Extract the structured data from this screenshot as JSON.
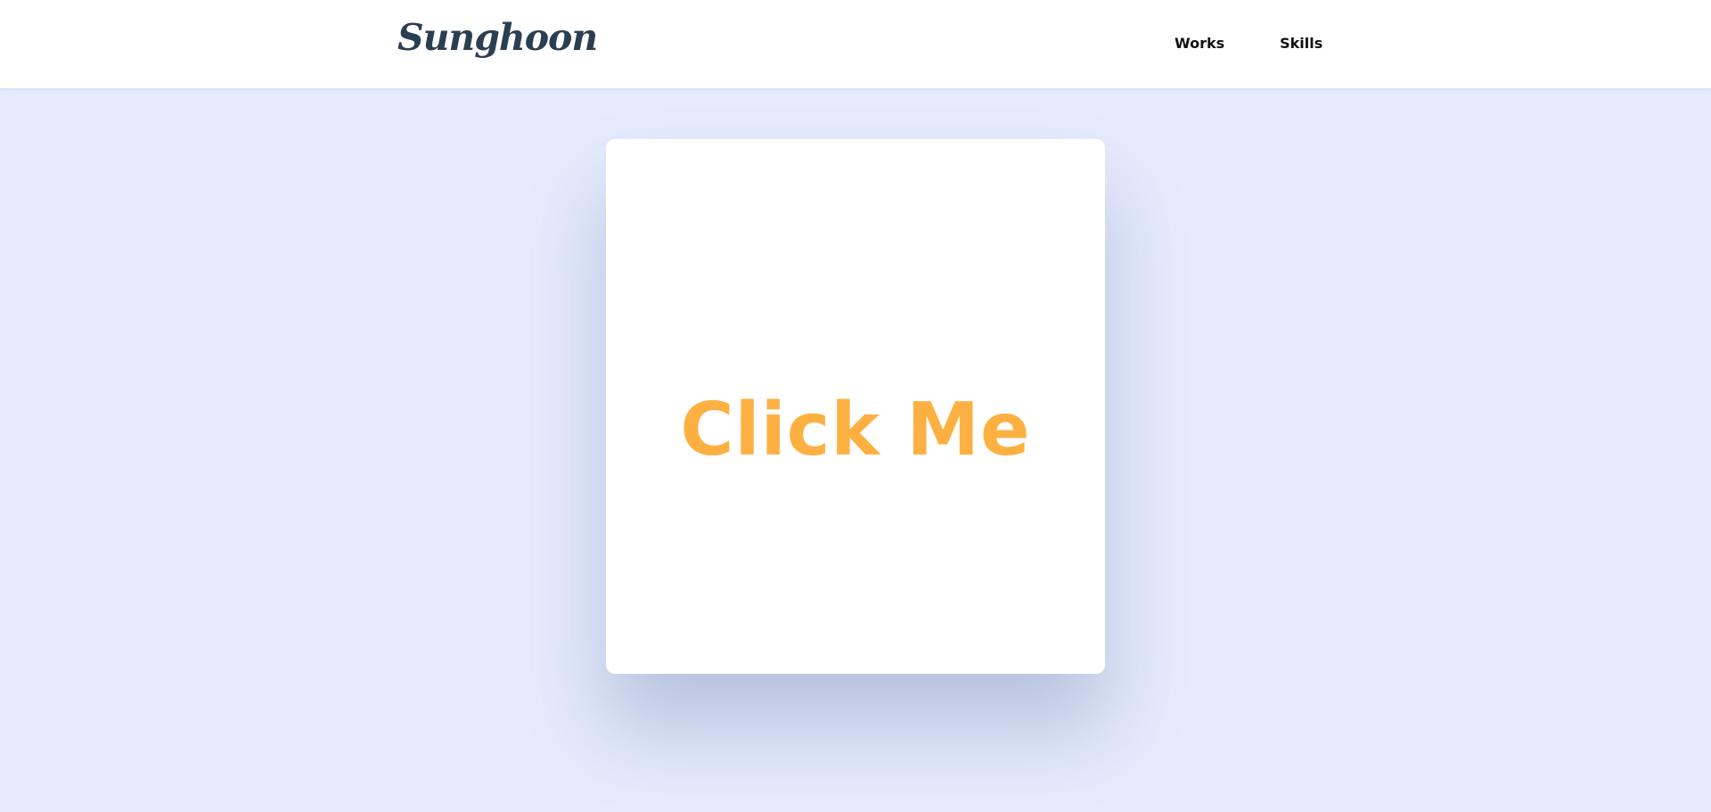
{
  "header": {
    "logo_text": "Sunghoon",
    "nav": [
      {
        "label": "Works"
      },
      {
        "label": "Skills"
      }
    ]
  },
  "main": {
    "card_label": "Click Me"
  },
  "colors": {
    "background": "#e5ebfd",
    "header_bg": "#ffffff",
    "logo": "#2b3e52",
    "nav_text": "#111111",
    "card_bg": "#ffffff",
    "card_label": "#fdb042"
  }
}
